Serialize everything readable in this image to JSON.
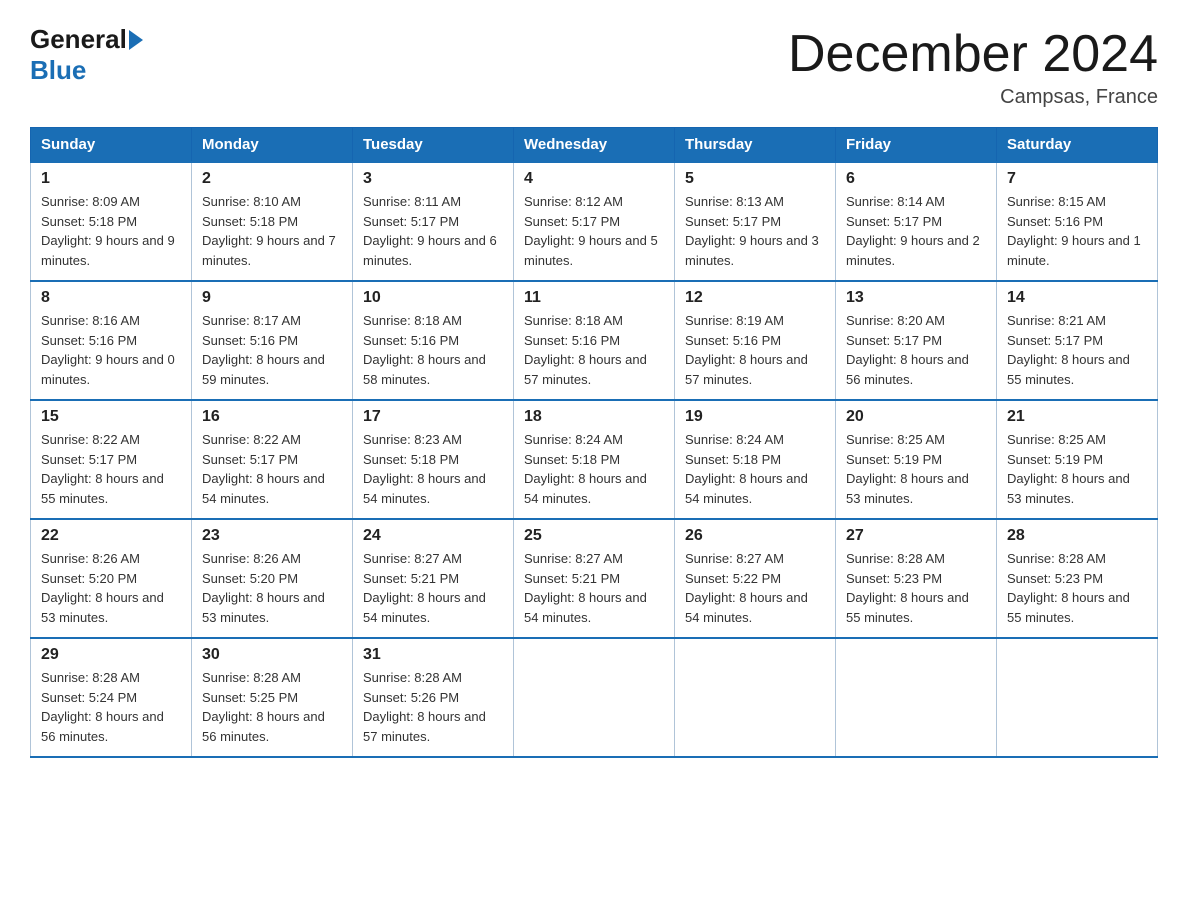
{
  "logo": {
    "general": "General",
    "blue": "Blue"
  },
  "header": {
    "title": "December 2024",
    "subtitle": "Campsas, France"
  },
  "weekdays": [
    "Sunday",
    "Monday",
    "Tuesday",
    "Wednesday",
    "Thursday",
    "Friday",
    "Saturday"
  ],
  "weeks": [
    [
      {
        "day": "1",
        "sunrise": "8:09 AM",
        "sunset": "5:18 PM",
        "daylight": "9 hours and 9 minutes."
      },
      {
        "day": "2",
        "sunrise": "8:10 AM",
        "sunset": "5:18 PM",
        "daylight": "9 hours and 7 minutes."
      },
      {
        "day": "3",
        "sunrise": "8:11 AM",
        "sunset": "5:17 PM",
        "daylight": "9 hours and 6 minutes."
      },
      {
        "day": "4",
        "sunrise": "8:12 AM",
        "sunset": "5:17 PM",
        "daylight": "9 hours and 5 minutes."
      },
      {
        "day": "5",
        "sunrise": "8:13 AM",
        "sunset": "5:17 PM",
        "daylight": "9 hours and 3 minutes."
      },
      {
        "day": "6",
        "sunrise": "8:14 AM",
        "sunset": "5:17 PM",
        "daylight": "9 hours and 2 minutes."
      },
      {
        "day": "7",
        "sunrise": "8:15 AM",
        "sunset": "5:16 PM",
        "daylight": "9 hours and 1 minute."
      }
    ],
    [
      {
        "day": "8",
        "sunrise": "8:16 AM",
        "sunset": "5:16 PM",
        "daylight": "9 hours and 0 minutes."
      },
      {
        "day": "9",
        "sunrise": "8:17 AM",
        "sunset": "5:16 PM",
        "daylight": "8 hours and 59 minutes."
      },
      {
        "day": "10",
        "sunrise": "8:18 AM",
        "sunset": "5:16 PM",
        "daylight": "8 hours and 58 minutes."
      },
      {
        "day": "11",
        "sunrise": "8:18 AM",
        "sunset": "5:16 PM",
        "daylight": "8 hours and 57 minutes."
      },
      {
        "day": "12",
        "sunrise": "8:19 AM",
        "sunset": "5:16 PM",
        "daylight": "8 hours and 57 minutes."
      },
      {
        "day": "13",
        "sunrise": "8:20 AM",
        "sunset": "5:17 PM",
        "daylight": "8 hours and 56 minutes."
      },
      {
        "day": "14",
        "sunrise": "8:21 AM",
        "sunset": "5:17 PM",
        "daylight": "8 hours and 55 minutes."
      }
    ],
    [
      {
        "day": "15",
        "sunrise": "8:22 AM",
        "sunset": "5:17 PM",
        "daylight": "8 hours and 55 minutes."
      },
      {
        "day": "16",
        "sunrise": "8:22 AM",
        "sunset": "5:17 PM",
        "daylight": "8 hours and 54 minutes."
      },
      {
        "day": "17",
        "sunrise": "8:23 AM",
        "sunset": "5:18 PM",
        "daylight": "8 hours and 54 minutes."
      },
      {
        "day": "18",
        "sunrise": "8:24 AM",
        "sunset": "5:18 PM",
        "daylight": "8 hours and 54 minutes."
      },
      {
        "day": "19",
        "sunrise": "8:24 AM",
        "sunset": "5:18 PM",
        "daylight": "8 hours and 54 minutes."
      },
      {
        "day": "20",
        "sunrise": "8:25 AM",
        "sunset": "5:19 PM",
        "daylight": "8 hours and 53 minutes."
      },
      {
        "day": "21",
        "sunrise": "8:25 AM",
        "sunset": "5:19 PM",
        "daylight": "8 hours and 53 minutes."
      }
    ],
    [
      {
        "day": "22",
        "sunrise": "8:26 AM",
        "sunset": "5:20 PM",
        "daylight": "8 hours and 53 minutes."
      },
      {
        "day": "23",
        "sunrise": "8:26 AM",
        "sunset": "5:20 PM",
        "daylight": "8 hours and 53 minutes."
      },
      {
        "day": "24",
        "sunrise": "8:27 AM",
        "sunset": "5:21 PM",
        "daylight": "8 hours and 54 minutes."
      },
      {
        "day": "25",
        "sunrise": "8:27 AM",
        "sunset": "5:21 PM",
        "daylight": "8 hours and 54 minutes."
      },
      {
        "day": "26",
        "sunrise": "8:27 AM",
        "sunset": "5:22 PM",
        "daylight": "8 hours and 54 minutes."
      },
      {
        "day": "27",
        "sunrise": "8:28 AM",
        "sunset": "5:23 PM",
        "daylight": "8 hours and 55 minutes."
      },
      {
        "day": "28",
        "sunrise": "8:28 AM",
        "sunset": "5:23 PM",
        "daylight": "8 hours and 55 minutes."
      }
    ],
    [
      {
        "day": "29",
        "sunrise": "8:28 AM",
        "sunset": "5:24 PM",
        "daylight": "8 hours and 56 minutes."
      },
      {
        "day": "30",
        "sunrise": "8:28 AM",
        "sunset": "5:25 PM",
        "daylight": "8 hours and 56 minutes."
      },
      {
        "day": "31",
        "sunrise": "8:28 AM",
        "sunset": "5:26 PM",
        "daylight": "8 hours and 57 minutes."
      },
      null,
      null,
      null,
      null
    ]
  ],
  "labels": {
    "sunrise": "Sunrise:",
    "sunset": "Sunset:",
    "daylight": "Daylight:"
  }
}
